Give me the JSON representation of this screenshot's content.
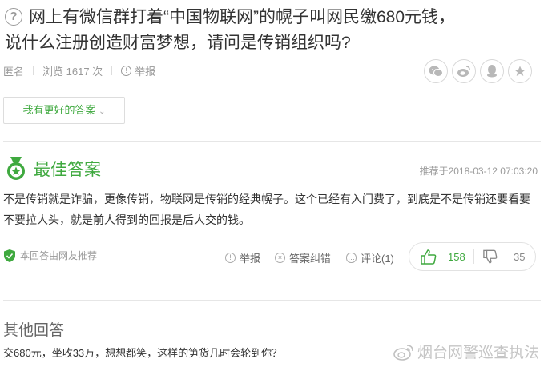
{
  "question": {
    "title_line1": "网上有微信群打着“中国物联网”的幌子叫网民缴680元钱，",
    "title_line2": "说什么注册创造财富梦想，请问是传销组织吗?",
    "icon": "question-circle-icon"
  },
  "meta": {
    "author": "匿名",
    "views": "浏览 1617 次",
    "report": "举报"
  },
  "share": {
    "icons": [
      "wechat-icon",
      "weibo-icon",
      "qq-icon",
      "favorite-star-icon"
    ]
  },
  "better_answer_button": "我有更好的答案",
  "best_answer": {
    "heading": "最佳答案",
    "time": "推荐于2018-03-12 07:03:20",
    "text": "不是传销就是诈骗，更像传销，物联网是传销的经典幌子。这个已经有入门费了，到底是不是传销还要看要不要拉人头，就是前人得到的回报是后人交的钱。",
    "recommended_by": "本回答由网友推荐",
    "actions": {
      "report": "举报",
      "correct": "答案纠错",
      "comment": "评论(1)"
    },
    "votes": {
      "up": "158",
      "down": "35"
    },
    "accent_color": "#3fa93f"
  },
  "other_answers": {
    "heading": "其他回答",
    "items": [
      "交680元，坐收33万，想想都笑，这样的笋货几时会轮到你？"
    ]
  },
  "watermark": {
    "text": "烟台网警巡查执法"
  }
}
